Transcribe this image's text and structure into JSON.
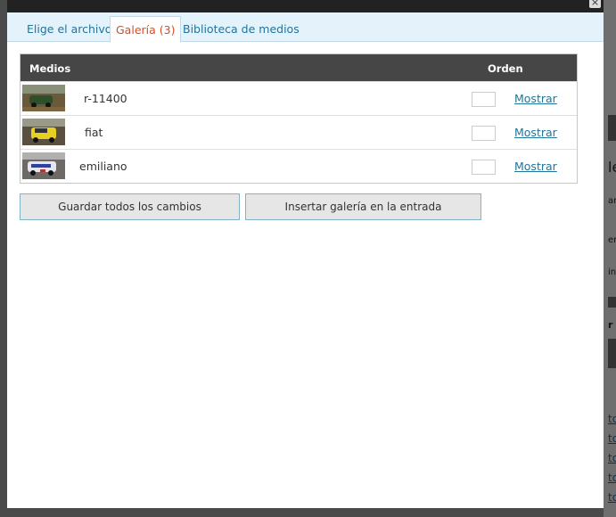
{
  "modal": {
    "close_glyph": "×"
  },
  "tabs": [
    {
      "label": "Elige el archivo"
    },
    {
      "label": "Galería (3)"
    },
    {
      "label": "Biblioteca de medios"
    }
  ],
  "table": {
    "headers": {
      "media": "Medios",
      "order": "Orden"
    },
    "rows": [
      {
        "name": "r-11400",
        "action": "Mostrar",
        "order": ""
      },
      {
        "name": "fiat",
        "action": "Mostrar",
        "order": ""
      },
      {
        "name": "emiliano",
        "action": "Mostrar",
        "order": ""
      }
    ]
  },
  "buttons": {
    "save_all": "Guardar todos los cambios",
    "insert_gallery": "Insertar galería en la entrada"
  },
  "backdrop": {
    "snippets": [
      "le",
      "ar",
      "er",
      "in",
      "r",
      "to",
      "to",
      "to",
      "to",
      "to"
    ]
  },
  "colors": {
    "tab_link": "#21759b",
    "tab_active": "#d54e21",
    "header_bg": "#464646",
    "tabbar_bg": "#e4f2fc"
  }
}
